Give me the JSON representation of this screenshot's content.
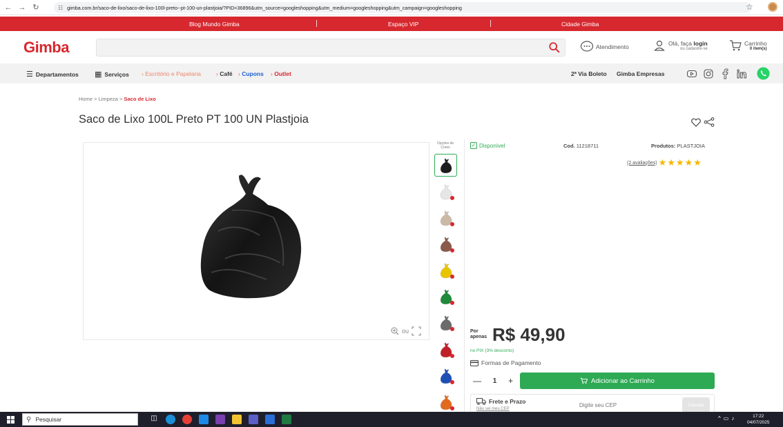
{
  "browser": {
    "url": "gimba.com.br/saco-de-lixo/saco-de-lixo-100l-preto--pt-100-un-plastjoia/?PID=36896&utm_source=googleshopping&utm_medium=googleshopping&utm_campaign=googleshopping"
  },
  "topbar": {
    "links": [
      "Blog Mundo Gimba",
      "Espaço VIP",
      "Cidade Gimba"
    ]
  },
  "header": {
    "logo": "Gimba",
    "search_placeholder": "",
    "atendimento": "Atendimento",
    "login_prefix": "Olá, faça ",
    "login_strong": "login",
    "login_sub": "ou cadastre-se",
    "cart_label": "Carrinho",
    "cart_count": "0 item(s)"
  },
  "catnav": {
    "departamentos": "Departamentos",
    "servicos": "Serviços",
    "escritorio": "Escritório e Papelaria",
    "cafe": "Café",
    "cupons": "Cupons",
    "outlet": "Outlet",
    "boleto": "2ª Via Boleto",
    "empresas": "Gimba Empresas"
  },
  "breadcrumb": {
    "home": "Home",
    "limpeza": "Limpeza",
    "current": "Saco de Lixo"
  },
  "product": {
    "title": "Saco de Lixo 100L Preto PT 100 UN Plastjoia",
    "colors_label": "Opções de Cores",
    "availability": "Disponível",
    "code_label": "Cod.",
    "code": "11218711",
    "brand_label": "Produtos:",
    "brand": "PLASTJOIA",
    "reviews": "(2 avaliações)",
    "rating": 5,
    "zoom_or": "ou",
    "price_label": "Por apenas",
    "price": "R$ 49,90",
    "pix": "no PIX (3% desconto)",
    "payment_forms": "Formas de Pagamento",
    "quantity": "1",
    "add_to_cart": "Adicionar ao Carrinho",
    "freight_title": "Frete e Prazo",
    "freight_sub": "Não sei meu CEP",
    "cep_placeholder": "Digite seu CEP",
    "calc_label": "Calcular",
    "swatches": [
      {
        "name": "preto",
        "color": "#1c1c1c"
      },
      {
        "name": "branco",
        "color": "#e6e6e6"
      },
      {
        "name": "bege",
        "color": "#cbb9a6"
      },
      {
        "name": "marrom",
        "color": "#8a5a4a"
      },
      {
        "name": "amarelo",
        "color": "#e8c400"
      },
      {
        "name": "verde",
        "color": "#1f8a3a"
      },
      {
        "name": "cinza",
        "color": "#6b6b6b"
      },
      {
        "name": "vermelho",
        "color": "#c0202a"
      },
      {
        "name": "azul",
        "color": "#1e4fb5"
      },
      {
        "name": "laranja",
        "color": "#e26a1f"
      }
    ]
  },
  "taskbar": {
    "search": "Pesquisar",
    "time": "17:22",
    "date": "04/07/2025"
  },
  "colors": {
    "brand_red": "#d7282f",
    "green": "#2eaa55",
    "star": "#f5b700"
  }
}
